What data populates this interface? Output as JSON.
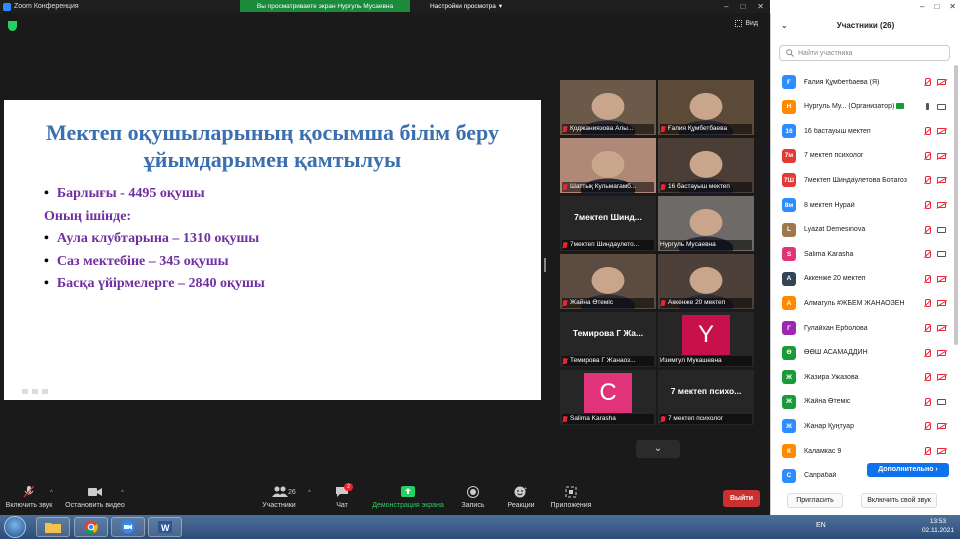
{
  "window": {
    "title": "Zoom Конференция",
    "controls": [
      "–",
      "□",
      "✕"
    ]
  },
  "banner": {
    "text": "Вы просматриваете экран Нургуль Мусаевна",
    "view_options": "Настройки просмотра"
  },
  "view_label": "Вид",
  "slide": {
    "title": "Мектеп оқушыларының қосымша білім беру ұйымдарымен қамтылуы",
    "lines": [
      {
        "bullet": true,
        "text": "Барлығы - 4495 оқушы"
      },
      {
        "bullet": false,
        "text": "Оның ішінде:"
      },
      {
        "bullet": true,
        "text": "Аула клубтарына – 1310 оқушы"
      },
      {
        "bullet": true,
        "text": "Саз мектебіне – 345 оқушы"
      },
      {
        "bullet": true,
        "text": "Басқа үйірмелерге – 2840 оқушы"
      }
    ]
  },
  "tiles": [
    {
      "name": "Қоджаниязова Алы...",
      "type": "video",
      "bg": "#6b5a4a",
      "muted": true
    },
    {
      "name": "Ғалия Құмбетбаева",
      "type": "video",
      "bg": "#5b4a38",
      "muted": true
    },
    {
      "name": "Шаттық Кульмагамб...",
      "type": "video",
      "bg": "#b08878",
      "muted": true
    },
    {
      "name": "16 бастауыш мектеп",
      "type": "video",
      "bg": "#4a3e36",
      "muted": true
    },
    {
      "name": "7мектеп Шиндаулето...",
      "type": "label",
      "label": "7мектеп  Шинд...",
      "muted": true
    },
    {
      "name": "Нургуль Мусаевна",
      "type": "video",
      "bg": "#6e6a68",
      "muted": false,
      "active": true
    },
    {
      "name": "Жайна Өтеміс",
      "type": "video",
      "bg": "#5c4b40",
      "muted": true
    },
    {
      "name": "Аккенже 20 мектеп",
      "type": "video",
      "bg": "#4d4038",
      "muted": true
    },
    {
      "name": "Темирова Г Жанаоз...",
      "type": "label",
      "label": "Темирова Г Жа...",
      "muted": true
    },
    {
      "name": "Изимгул Мукашевна",
      "type": "avatar",
      "letter": "Y",
      "color": "#c8104c",
      "muted": false
    },
    {
      "name": "Salima Karasha",
      "type": "avatar",
      "letter": "C",
      "color": "#e0337a",
      "muted": true
    },
    {
      "name": "7 мектеп психолог",
      "type": "label",
      "label": "7 мектеп психо...",
      "muted": true
    }
  ],
  "toolbar": {
    "audio": "Включить звук",
    "video": "Остановить видео",
    "participants": "Участники",
    "participants_count": "26",
    "chat": "Чат",
    "chat_badge": "2",
    "share": "Демонстрация экрана",
    "record": "Запись",
    "reactions": "Реакции",
    "apps": "Приложения",
    "leave": "Выйти"
  },
  "panel": {
    "title": "Участники (26)",
    "search_placeholder": "Найти участника",
    "participants": [
      {
        "initials": "Ғ",
        "color": "#2d8cff",
        "name": "Ғалия Құмбетбаева (Я)",
        "mic": "off",
        "cam": "off"
      },
      {
        "initials": "Н",
        "color": "#ff8a00",
        "name": "Нургуль Му...  (Организатор)",
        "mic": "host",
        "cam": "on"
      },
      {
        "initials": "16",
        "color": "#2d8cff",
        "name": "16 бастауыш мектеп",
        "mic": "off",
        "cam": "off"
      },
      {
        "initials": "7м",
        "color": "#e53935",
        "name": "7 мектеп психолог",
        "mic": "off",
        "cam": "off"
      },
      {
        "initials": "7Ш",
        "color": "#e53935",
        "name": "7мектеп Шиндаулетова Ботагоз",
        "mic": "off",
        "cam": "off"
      },
      {
        "initials": "8м",
        "color": "#2d8cff",
        "name": "8 мектеп Нурай",
        "mic": "off",
        "cam": "off"
      },
      {
        "initials": "L",
        "color": "#a07850",
        "name": "Lyazat Demesinova",
        "mic": "off",
        "cam": "on"
      },
      {
        "initials": "S",
        "color": "#e0337a",
        "name": "Salima Karasha",
        "mic": "off",
        "cam": "on"
      },
      {
        "initials": "А",
        "color": "#334455",
        "name": "Аккенже 20 мектеп",
        "mic": "off",
        "cam": "off"
      },
      {
        "initials": "А",
        "color": "#ff8a00",
        "name": "Алмагуль #ЖБЕМ ЖАНАОЗЕН",
        "mic": "off",
        "cam": "off"
      },
      {
        "initials": "Г",
        "color": "#9c27b0",
        "name": "Гулайхан Ерболова",
        "mic": "off",
        "cam": "off"
      },
      {
        "initials": "Ө",
        "color": "#1b9a3a",
        "name": "ӨӨШ АСАМАДДИН",
        "mic": "off",
        "cam": "off"
      },
      {
        "initials": "Ж",
        "color": "#1b9a3a",
        "name": "Жазира Ужазова",
        "mic": "off",
        "cam": "off"
      },
      {
        "initials": "Ж",
        "color": "#1b9a3a",
        "name": "Жайна Өтеміс",
        "mic": "off",
        "cam": "on"
      },
      {
        "initials": "Ж",
        "color": "#2d8cff",
        "name": "Жанар Қуңтуар",
        "mic": "off",
        "cam": "off"
      },
      {
        "initials": "К",
        "color": "#ff8a00",
        "name": "Каламкас 9",
        "mic": "off",
        "cam": "off"
      },
      {
        "initials": "С",
        "color": "#2d8cff",
        "name": "Сапрабай",
        "mic": "",
        "cam": ""
      }
    ],
    "more_button": "Дополнительно ›",
    "invite": "Пригласить",
    "unmute": "Включить свой звук"
  },
  "taskbar": {
    "lang": "EN",
    "time": "13:53",
    "date": "02.11.2021"
  }
}
